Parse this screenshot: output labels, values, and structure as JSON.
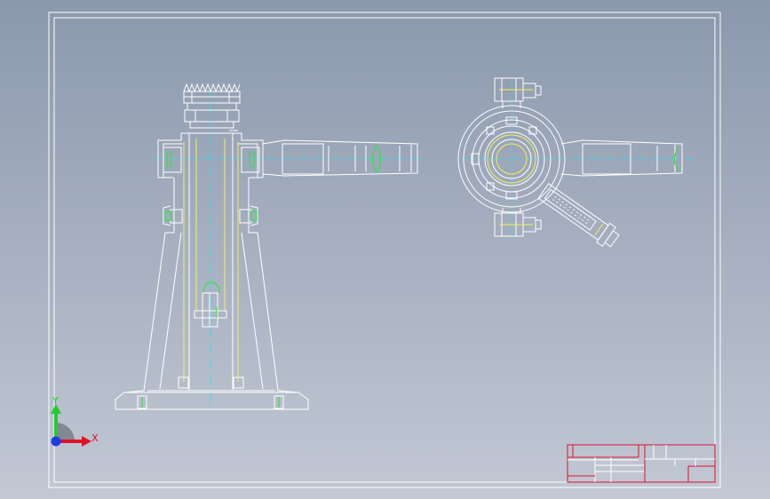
{
  "viewport": {
    "background_top": "#8b98ad",
    "background_bottom": "#c2c8d4"
  },
  "colors": {
    "outline": "#ffffff",
    "hidden_edge": "#f2f25a",
    "thread_marker": "#36e04a",
    "centerline": "#2fe0e8",
    "title_block": "#e0102a"
  },
  "triad": {
    "x_label": "X",
    "y_label": "Y",
    "x_color": "#e0102a",
    "y_color": "#22cc33",
    "z_color": "#1a3fe0"
  },
  "views": [
    "front-section-view",
    "top-view"
  ]
}
